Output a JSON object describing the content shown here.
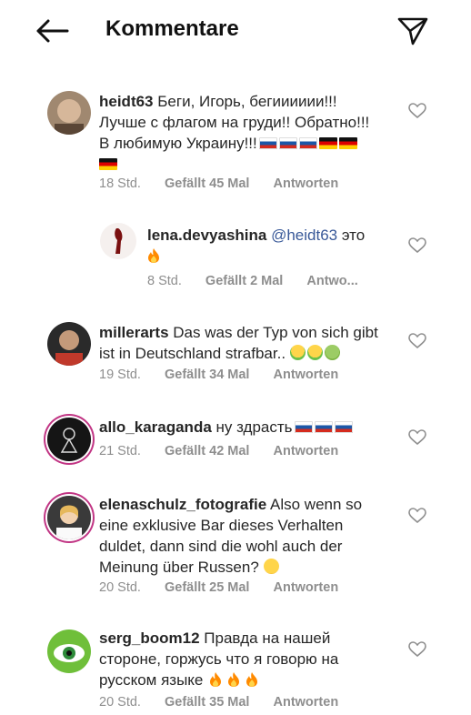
{
  "header": {
    "title": "Kommentare",
    "back_icon": "arrow-left-icon",
    "send_icon": "paper-plane-icon"
  },
  "comments": [
    {
      "username": "heidt63",
      "lines": [
        "Беги, Игорь, бегииииии!!!",
        "Лучше с флагом на груди!! Обратно!!!",
        "В любимую Украину!!!"
      ],
      "time": "18 Std.",
      "likes": "Gefällt 45 Mal",
      "reply_label": "Antworten",
      "emoji": [
        "flag-ru",
        "flag-ru",
        "flag-ru",
        "flag-de",
        "flag-de",
        "flag-de"
      ]
    },
    {
      "username": "lena.devyashina",
      "mention": "@heidt63",
      "text": "это",
      "time": "8 Std.",
      "likes": "Gefällt 2 Mal",
      "reply_label": "Antwo...",
      "emoji": [
        "fire"
      ]
    },
    {
      "username": "millerarts",
      "lines": [
        "Das was der Typ von sich gibt",
        "ist in Deutschland strafbar.."
      ],
      "time": "19 Std.",
      "likes": "Gefällt 34 Mal",
      "reply_label": "Antworten",
      "emoji": [
        "face-vomiting",
        "face-vomiting",
        "face-nauseated"
      ]
    },
    {
      "username": "allo_karaganda",
      "text": "ну здрасть",
      "time": "21 Std.",
      "likes": "Gefällt 42 Mal",
      "reply_label": "Antworten",
      "emoji": [
        "flag-ru",
        "flag-ru",
        "flag-ru"
      ]
    },
    {
      "username": "elenaschulz_fotografie",
      "lines": [
        "Also wenn so",
        "eine exklusive Bar dieses Verhalten",
        "duldet, dann sind die wohl auch der",
        "Meinung über Russen?"
      ],
      "time": "20 Std.",
      "likes": "Gefällt 25 Mal",
      "reply_label": "Antworten",
      "emoji": [
        "face-monocle"
      ]
    },
    {
      "username": "serg_boom12",
      "lines": [
        "Правда на нашей",
        "стороне, горжусь что я говорю на",
        "русском языке"
      ],
      "time": "20 Std.",
      "likes": "Gefällt 35 Mal",
      "reply_label": "Antworten",
      "emoji": [
        "fire",
        "fire",
        "fire"
      ]
    }
  ]
}
